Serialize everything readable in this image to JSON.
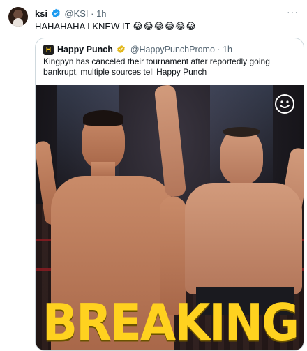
{
  "tweet": {
    "author_name": "ksi",
    "handle": "@KSI",
    "separator": "·",
    "time": "1h",
    "more_label": "···",
    "text": "HAHAHAHA I KNEW IT 😂😂😂😂😂😂"
  },
  "quoted": {
    "avatar_letter": "H",
    "author_name": "Happy Punch",
    "handle": "@HappyPunchPromo",
    "separator": "·",
    "time": "1h",
    "text": "Kingpyn has canceled their tournament after reportedly going bankrupt, multiple sources tell Happy Punch",
    "image_overlay_text": "BREAKING"
  },
  "colors": {
    "verified_blue": "#1d9bf0",
    "verified_gold": "#e2b719",
    "breaking_yellow": "#ffd21f"
  },
  "icons": {
    "verified": "verified-badge-icon",
    "gold": "gold-verified-badge-icon",
    "more": "more-options-icon",
    "logo": "smiley-logo-icon"
  }
}
